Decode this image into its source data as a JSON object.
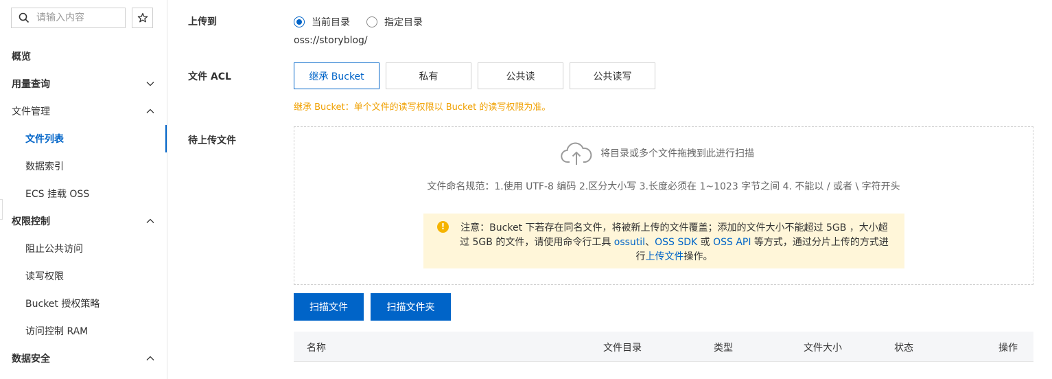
{
  "sidebar": {
    "search_placeholder": "请输入内容",
    "items": [
      {
        "label": "概览"
      },
      {
        "label": "用量查询"
      },
      {
        "label": "文件管理"
      },
      {
        "label": "文件列表"
      },
      {
        "label": "数据索引"
      },
      {
        "label": "ECS 挂载 OSS"
      },
      {
        "label": "权限控制"
      },
      {
        "label": "阻止公共访问"
      },
      {
        "label": "读写权限"
      },
      {
        "label": "Bucket 授权策略"
      },
      {
        "label": "访问控制 RAM"
      },
      {
        "label": "数据安全"
      }
    ]
  },
  "upload_to": {
    "label": "上传到",
    "options": [
      "当前目录",
      "指定目录"
    ],
    "selected": "当前目录",
    "path": "oss://storyblog/"
  },
  "acl": {
    "label": "文件 ACL",
    "options": [
      "继承 Bucket",
      "私有",
      "公共读",
      "公共读写"
    ],
    "selected": "继承 Bucket",
    "hint": "继承 Bucket：单个文件的读写权限以 Bucket 的读写权限为准。"
  },
  "pending": {
    "label": "待上传文件",
    "drop_text": "将目录或多个文件拖拽到此进行扫描",
    "rules": "文件命名规范：1.使用 UTF-8 编码 2.区分大小写 3.长度必须在 1~1023 字节之间 4. 不能以 / 或者 \\ 字符开头",
    "notice": {
      "part1": "注意：Bucket 下若存在同名文件，将被新上传的文件覆盖；添加的文件大小不能超过 5GB ，大小超过 5GB 的文件，请使用命令行工具 ",
      "link1": "ossutil",
      "sep1": "、",
      "link2": "OSS SDK",
      "sep2": " 或 ",
      "link3": "OSS API",
      "part2": " 等方式，通过分片上传的方式进行",
      "link4": "上传文件",
      "part3": "操作。"
    }
  },
  "buttons": {
    "scan_files": "扫描文件",
    "scan_folder": "扫描文件夹"
  },
  "table": {
    "columns": [
      "名称",
      "文件目录",
      "类型",
      "文件大小",
      "状态",
      "操作"
    ]
  },
  "colors": {
    "primary": "#0064c8",
    "hint": "#f0a000",
    "notice_bg": "#fff6d9"
  }
}
